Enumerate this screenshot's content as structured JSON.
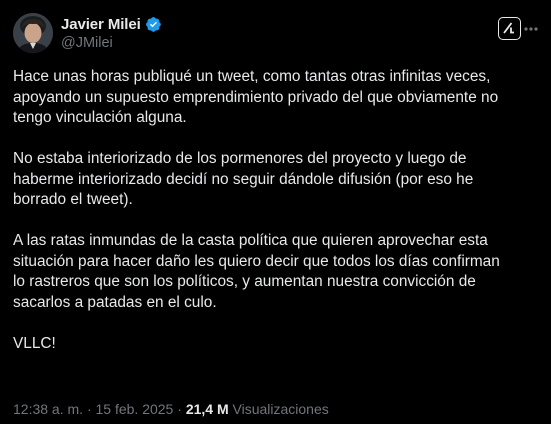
{
  "author": {
    "display_name": "Javier Milei",
    "handle": "@JMilei",
    "verified": true,
    "verified_color": "#1d9bf0"
  },
  "tweet": {
    "paragraphs": [
      "Hace unas horas publiqué un tweet, como tantas otras infinitas veces,\napoyando un supuesto emprendimiento privado del que obviamente no\ntengo vinculación alguna.",
      "No estaba interiorizado de los pormenores del proyecto y luego de\nhaberme interiorizado decidí no seguir dándole difusión (por eso he\nborrado el tweet).",
      "A las ratas inmundas de la casta política que quieren aprovechar esta\nsituación para hacer daño les quiero decir que todos los días confirman\nlo rastreros que son los políticos, y aumentan nuestra convicción de\nsacarlos a patadas en el culo.",
      "VLLC!"
    ],
    "time": "12:38 a. m.",
    "separator": "·",
    "date": "15 feb. 2025",
    "views_count": "21,4 M",
    "views_label": "Visualizaciones"
  },
  "icons": {
    "verified": "verified-badge-icon",
    "grok": "grok-icon",
    "more": "more-options-icon"
  },
  "colors": {
    "background": "#000000",
    "text": "#e7e9ea",
    "secondary": "#71767b"
  }
}
